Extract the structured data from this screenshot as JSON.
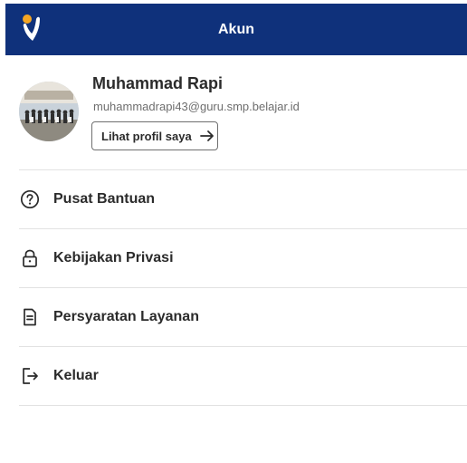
{
  "header": {
    "title": "Akun",
    "logo_icon": "brand-logo-icon",
    "background": "#0f317b"
  },
  "profile": {
    "name": "Muhammad Rapi",
    "email": "muhammadrapi43@guru.smp.belajar.id",
    "view_profile_label": "Lihat profil saya",
    "view_profile_icon": "arrow-right-icon"
  },
  "menu": [
    {
      "label": "Pusat Bantuan",
      "icon": "help-circle-icon"
    },
    {
      "label": "Kebijakan Privasi",
      "icon": "lock-icon"
    },
    {
      "label": "Persyaratan Layanan",
      "icon": "document-icon"
    },
    {
      "label": "Keluar",
      "icon": "logout-icon"
    }
  ]
}
